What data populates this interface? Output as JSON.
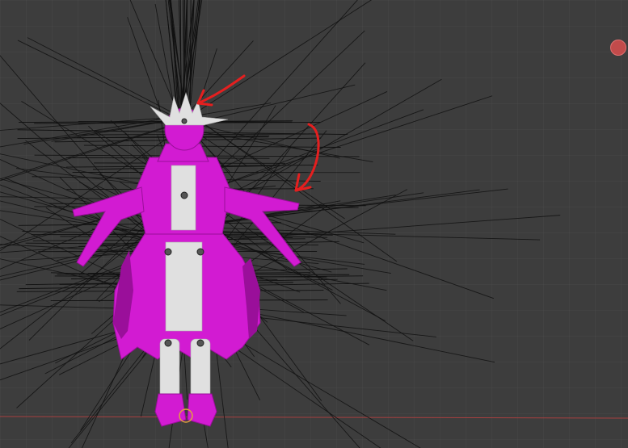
{
  "viewport": {
    "label": "",
    "background_color": "#3d3d3d",
    "model_color": "#d21bd2",
    "model_dark_color": "#9a0f9a",
    "mesh_highlight_color": "#e0e0e0",
    "bone_line_color": "#101010",
    "annotation_color": "#e51f1f",
    "x_axis_color": "#a84040"
  },
  "view_gizmo": {
    "icon": "view-axis-gizmo-icon",
    "fill": "#c24b4b",
    "border": "#e07070"
  },
  "annotations": [
    {
      "icon": "red-arrow-icon",
      "label": ""
    },
    {
      "icon": "red-arrow-icon",
      "label": ""
    }
  ]
}
